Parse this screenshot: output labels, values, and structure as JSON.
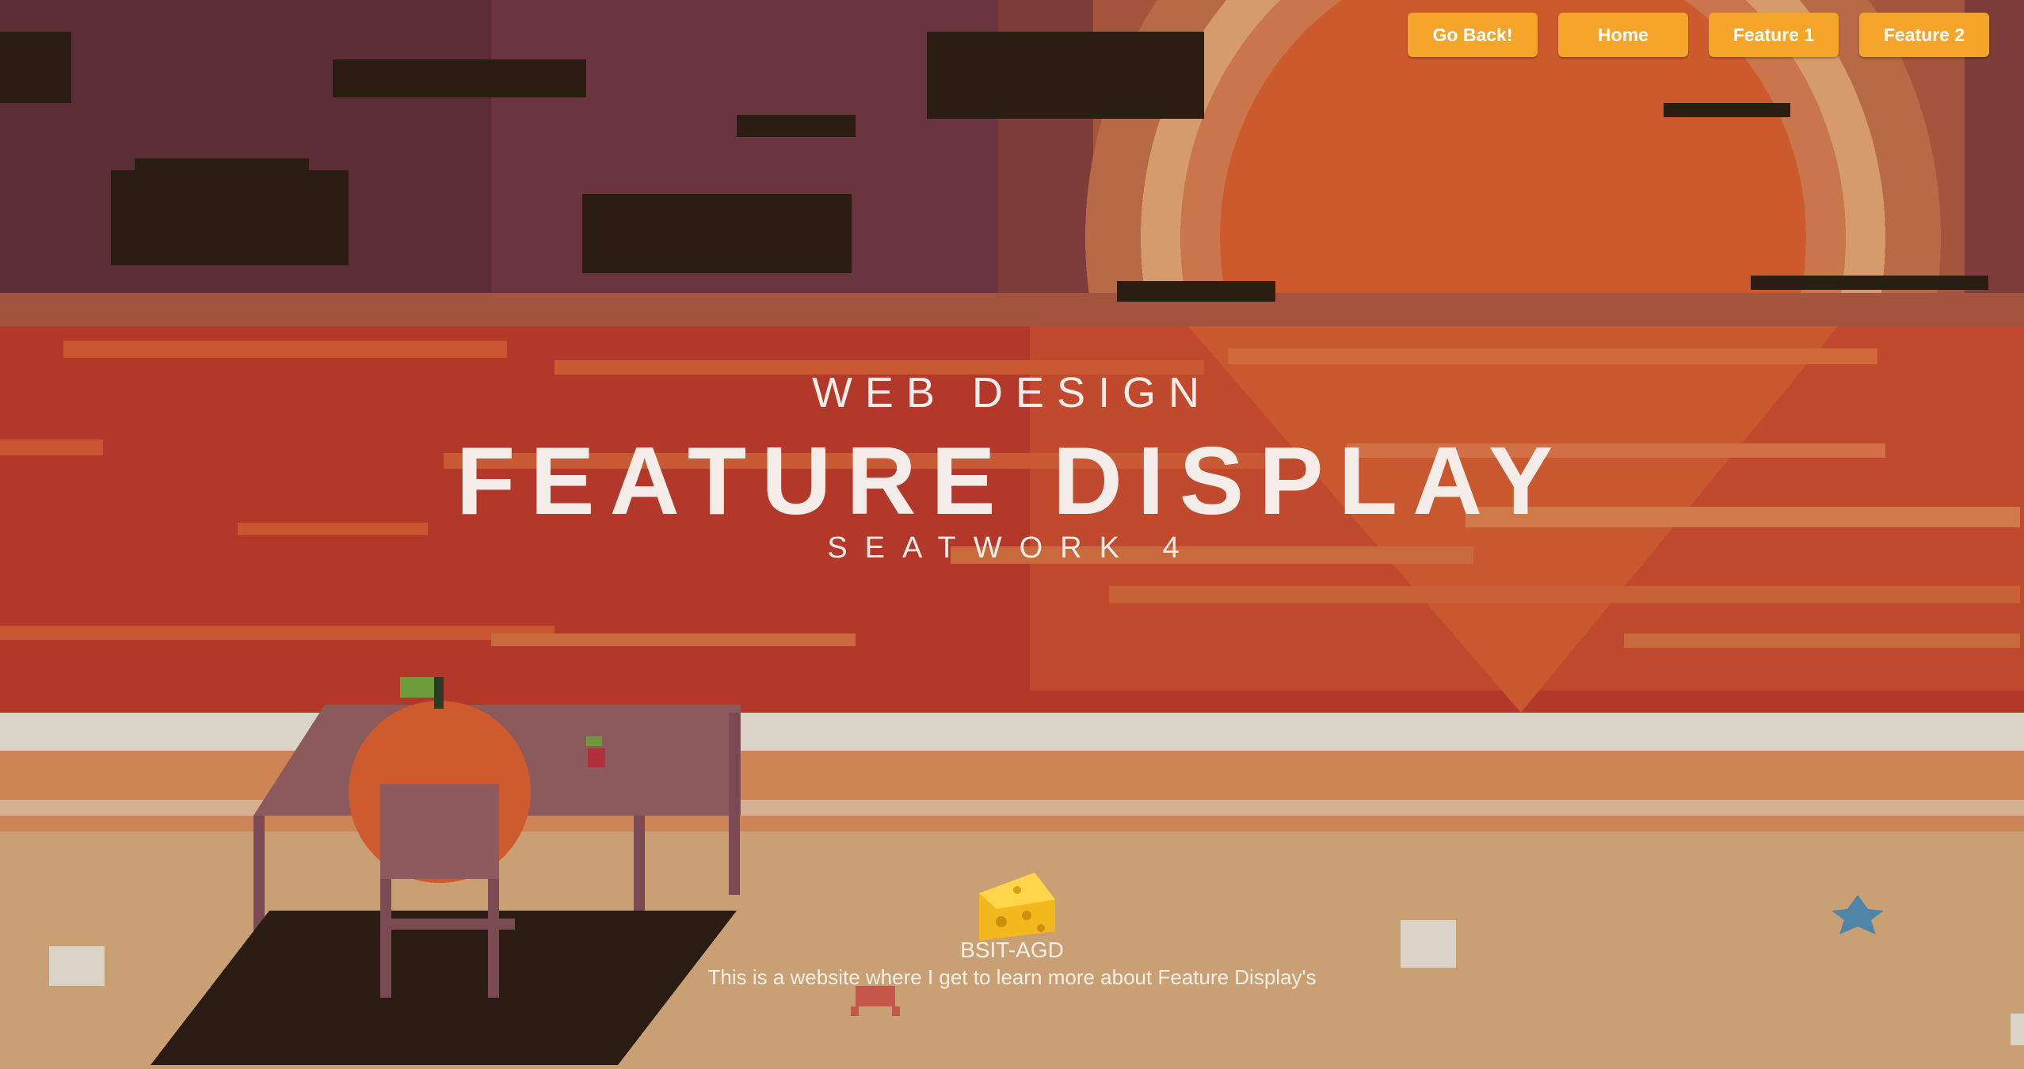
{
  "nav": {
    "buttons": [
      {
        "label": "Go Back!"
      },
      {
        "label": "Home"
      },
      {
        "label": "Feature 1"
      },
      {
        "label": "Feature 2"
      }
    ]
  },
  "hero": {
    "kicker": "WEB DESIGN",
    "title": "FEATURE DISPLAY",
    "subtitle": "SEATWORK 4"
  },
  "footer": {
    "org": "BSIT-AGD",
    "tagline": "This is a website where I get to learn more about Feature Display's"
  },
  "colors": {
    "nav_button": "#f5a52a",
    "sky": "#6e3740",
    "sun": "#cd5a2c",
    "sea": "#b23a28",
    "foam": "#d9d4c7",
    "sand": "#c9a074"
  },
  "icons": [
    "cheese-icon",
    "seashell-icon",
    "starfish-icon",
    "crab-icon",
    "cherry-icon",
    "tomato-icon"
  ]
}
